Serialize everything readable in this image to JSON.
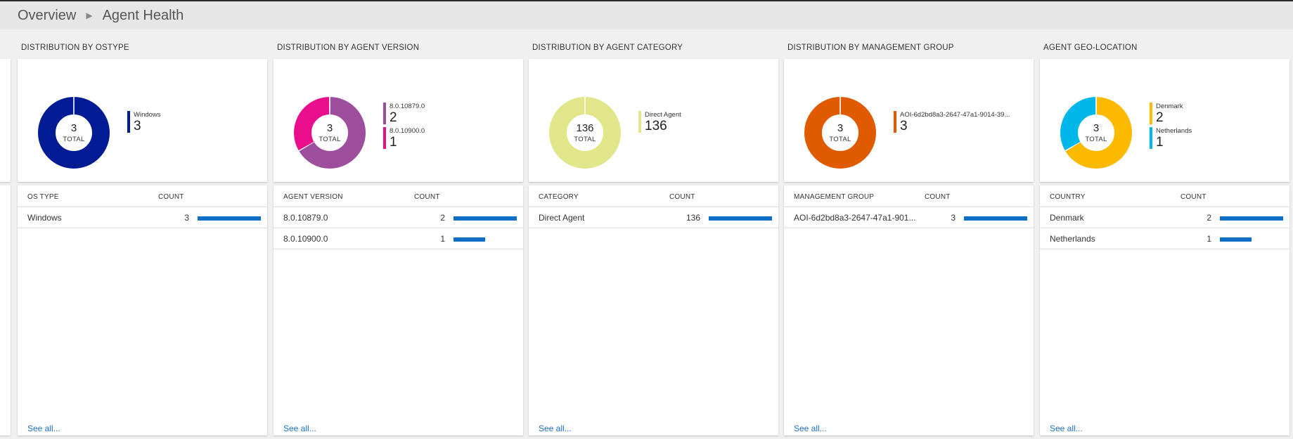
{
  "breadcrumb": {
    "items": [
      "Overview",
      "Agent Health"
    ]
  },
  "colors": {
    "bar": "#0f6fc6",
    "link": "#1e6fc1"
  },
  "tiles": [
    {
      "title": "DISTRIBUTION BY OSTYPE",
      "total": "3",
      "total_label": "TOTAL",
      "legend": [
        {
          "name": "Windows",
          "count": "3",
          "color": "#001b94"
        }
      ],
      "col_header": "OS TYPE",
      "count_header": "COUNT",
      "rows": [
        {
          "name": "Windows",
          "count": "3",
          "value": 3
        }
      ],
      "see_all": "See all..."
    },
    {
      "title": "DISTRIBUTION BY AGENT VERSION",
      "total": "3",
      "total_label": "TOTAL",
      "legend": [
        {
          "name": "8.0.10879.0",
          "count": "2",
          "color": "#9d4f9e"
        },
        {
          "name": "8.0.10900.0",
          "count": "1",
          "color": "#ea0e8c"
        }
      ],
      "col_header": "AGENT VERSION",
      "count_header": "COUNT",
      "rows": [
        {
          "name": "8.0.10879.0",
          "count": "2",
          "value": 2
        },
        {
          "name": "8.0.10900.0",
          "count": "1",
          "value": 1
        }
      ],
      "see_all": "See all..."
    },
    {
      "title": "DISTRIBUTION BY AGENT CATEGORY",
      "total": "136",
      "total_label": "TOTAL",
      "legend": [
        {
          "name": "Direct Agent",
          "count": "136",
          "color": "#e2e68a"
        }
      ],
      "col_header": "CATEGORY",
      "count_header": "COUNT",
      "rows": [
        {
          "name": "Direct Agent",
          "count": "136",
          "value": 136
        }
      ],
      "see_all": "See all..."
    },
    {
      "title": "DISTRIBUTION BY MANAGEMENT GROUP",
      "total": "3",
      "total_label": "TOTAL",
      "legend": [
        {
          "name": "AOI-6d2bd8a3-2647-47a1-9014-39...",
          "count": "3",
          "color": "#e05a00"
        }
      ],
      "col_header": "MANAGEMENT GROUP",
      "count_header": "COUNT",
      "rows": [
        {
          "name": "AOI-6d2bd8a3-2647-47a1-901...",
          "count": "3",
          "value": 3
        }
      ],
      "see_all": "See all..."
    },
    {
      "title": "AGENT GEO-LOCATION",
      "total": "3",
      "total_label": "TOTAL",
      "legend": [
        {
          "name": "Denmark",
          "count": "2",
          "color": "#fbb900"
        },
        {
          "name": "Netherlands",
          "count": "1",
          "color": "#00b7ec"
        }
      ],
      "col_header": "COUNTRY",
      "count_header": "COUNT",
      "rows": [
        {
          "name": "Denmark",
          "count": "2",
          "value": 2
        },
        {
          "name": "Netherlands",
          "count": "1",
          "value": 1
        }
      ],
      "see_all": "See all..."
    }
  ]
}
